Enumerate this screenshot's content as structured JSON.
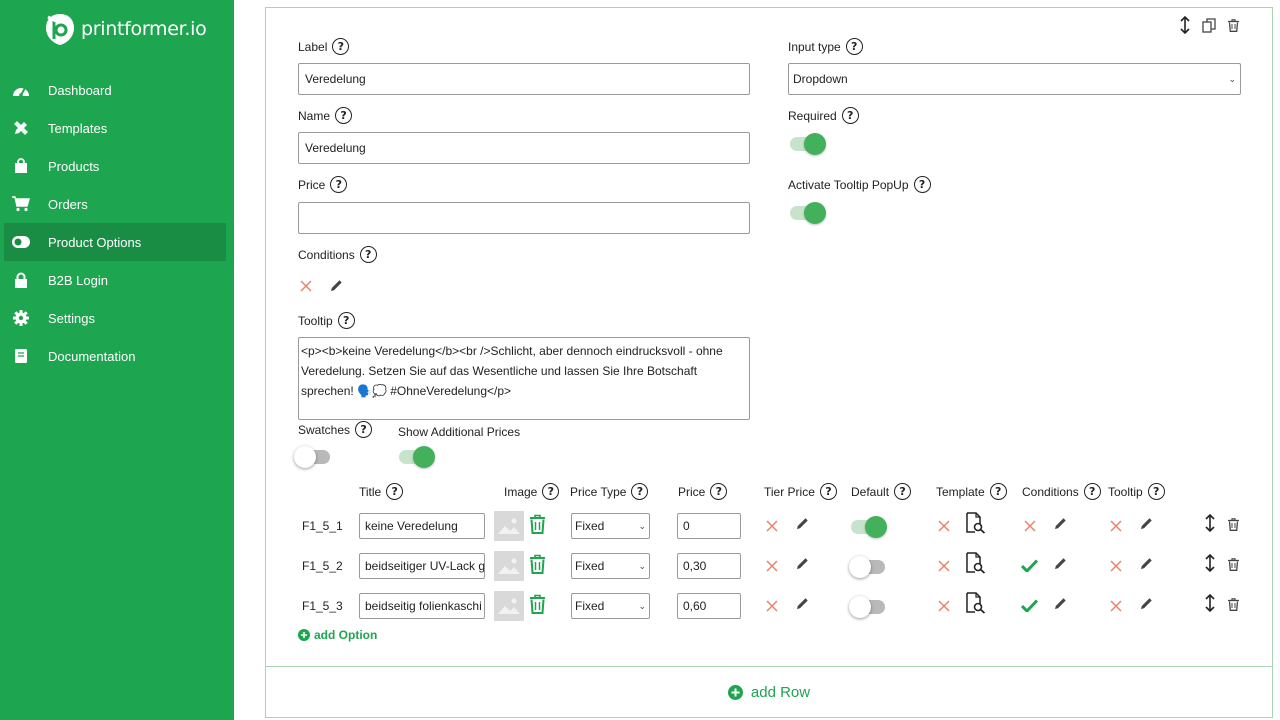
{
  "brand": {
    "name": "printformer.io",
    "color": "#1ea54f"
  },
  "sidebar": {
    "items": [
      {
        "label": "Dashboard",
        "icon": "dashboard-icon",
        "active": false
      },
      {
        "label": "Templates",
        "icon": "pencil-ruler-icon",
        "active": false
      },
      {
        "label": "Products",
        "icon": "shopping-bag-icon",
        "active": false
      },
      {
        "label": "Orders",
        "icon": "shopping-cart-icon",
        "active": false
      },
      {
        "label": "Product Options",
        "icon": "toggle-icon",
        "active": true
      },
      {
        "label": "B2B Login",
        "icon": "lock-icon",
        "active": false
      },
      {
        "label": "Settings",
        "icon": "gear-icon",
        "active": false
      },
      {
        "label": "Documentation",
        "icon": "book-icon",
        "active": false
      }
    ]
  },
  "form": {
    "label": {
      "title": "Label",
      "value": "Veredelung"
    },
    "name": {
      "title": "Name",
      "value": "Veredelung"
    },
    "price": {
      "title": "Price",
      "value": ""
    },
    "conditions": {
      "title": "Conditions"
    },
    "tooltip": {
      "title": "Tooltip",
      "value": "<p><b>keine Veredelung</b><br />Schlicht, aber dennoch eindrucksvoll - ohne Veredelung. Setzen Sie auf das Wesentliche und lassen Sie Ihre Botschaft sprechen! 🗣️💭 #OhneVeredelung</p>"
    },
    "input_type": {
      "title": "Input type",
      "value": "Dropdown"
    },
    "required": {
      "title": "Required",
      "on": true
    },
    "activate_tooltip": {
      "title": "Activate Tooltip PopUp",
      "on": true
    },
    "swatches": {
      "title": "Swatches",
      "on": false
    },
    "show_additional_prices": {
      "title": "Show Additional Prices",
      "on": true
    }
  },
  "options_table": {
    "headers": {
      "title": "Title",
      "image": "Image",
      "price_type": "Price Type",
      "price": "Price",
      "tier_price": "Tier Price",
      "default": "Default",
      "template": "Template",
      "conditions": "Conditions",
      "tooltip": "Tooltip"
    },
    "rows": [
      {
        "id": "F1_5_1",
        "title": "keine Veredelung",
        "price_type": "Fixed",
        "price": "0",
        "default_on": true,
        "conditions_set": false
      },
      {
        "id": "F1_5_2",
        "title": "beidseitiger UV-Lack g",
        "price_type": "Fixed",
        "price": "0,30",
        "default_on": false,
        "conditions_set": true
      },
      {
        "id": "F1_5_3",
        "title": "beidseitig folienkaschi",
        "price_type": "Fixed",
        "price": "0,60",
        "default_on": false,
        "conditions_set": true
      }
    ],
    "add_option_label": "add Option"
  },
  "add_row_label": "add Row"
}
